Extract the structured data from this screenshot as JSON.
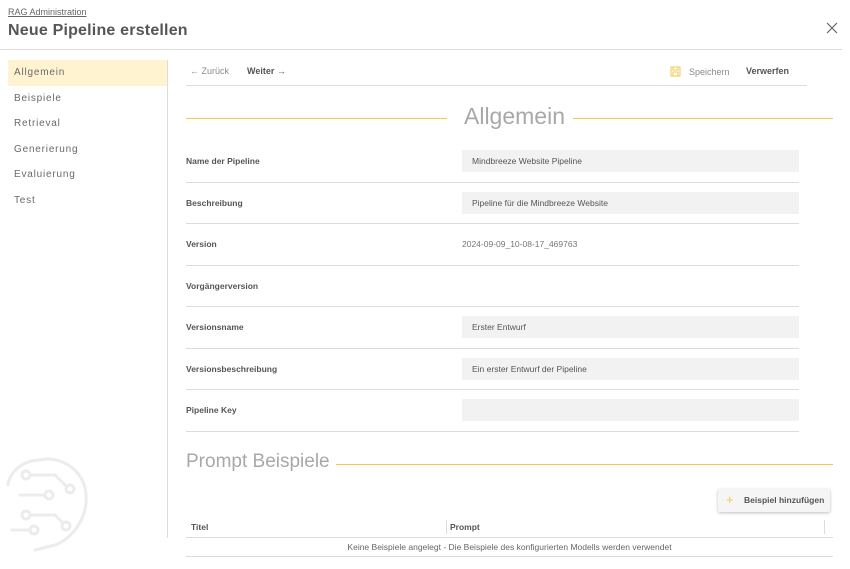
{
  "header": {
    "breadcrumb": "RAG Administration",
    "title": "Neue Pipeline erstellen",
    "close_icon": "close-icon"
  },
  "sidebar": {
    "items": [
      {
        "label": "Allgemein",
        "active": true
      },
      {
        "label": "Beispiele",
        "active": false
      },
      {
        "label": "Retrieval",
        "active": false
      },
      {
        "label": "Generierung",
        "active": false
      },
      {
        "label": "Evaluierung",
        "active": false
      },
      {
        "label": "Test",
        "active": false
      }
    ]
  },
  "toolbar": {
    "back_label": "← Zurück",
    "next_label": "Weiter →",
    "save_label": "Speichern",
    "save_icon": "save-icon",
    "discard_label": "Verwerfen"
  },
  "general": {
    "title": "Allgemein",
    "fields": [
      {
        "label": "Name der Pipeline",
        "value": "Mindbreeze Website Pipeline",
        "type": "input"
      },
      {
        "label": "Beschreibung",
        "value": "Pipeline für die Mindbreeze Website",
        "type": "input"
      },
      {
        "label": "Version",
        "value": "2024-09-09_10-08-17_469763",
        "type": "text"
      },
      {
        "label": "Vorgängerversion",
        "value": "",
        "type": "text"
      },
      {
        "label": "Versionsname",
        "value": "Erster Entwurf",
        "type": "input"
      },
      {
        "label": "Versionsbeschreibung",
        "value": "Ein erster Entwurf der Pipeline",
        "type": "input"
      },
      {
        "label": "Pipeline Key",
        "value": "",
        "type": "input"
      }
    ]
  },
  "prompt_examples": {
    "title": "Prompt Beispiele",
    "add_button_label": "Beispiel hinzufügen",
    "add_icon": "plus-icon",
    "columns": [
      "Titel",
      "Prompt"
    ],
    "empty_message": "Keine Beispiele angelegt - Die Beispiele des konfigurierten Modells werden verwendet"
  },
  "colors": {
    "accent": "#f2c94c",
    "active_nav_bg": "#fff3d0",
    "input_bg": "#f2f2f2"
  }
}
